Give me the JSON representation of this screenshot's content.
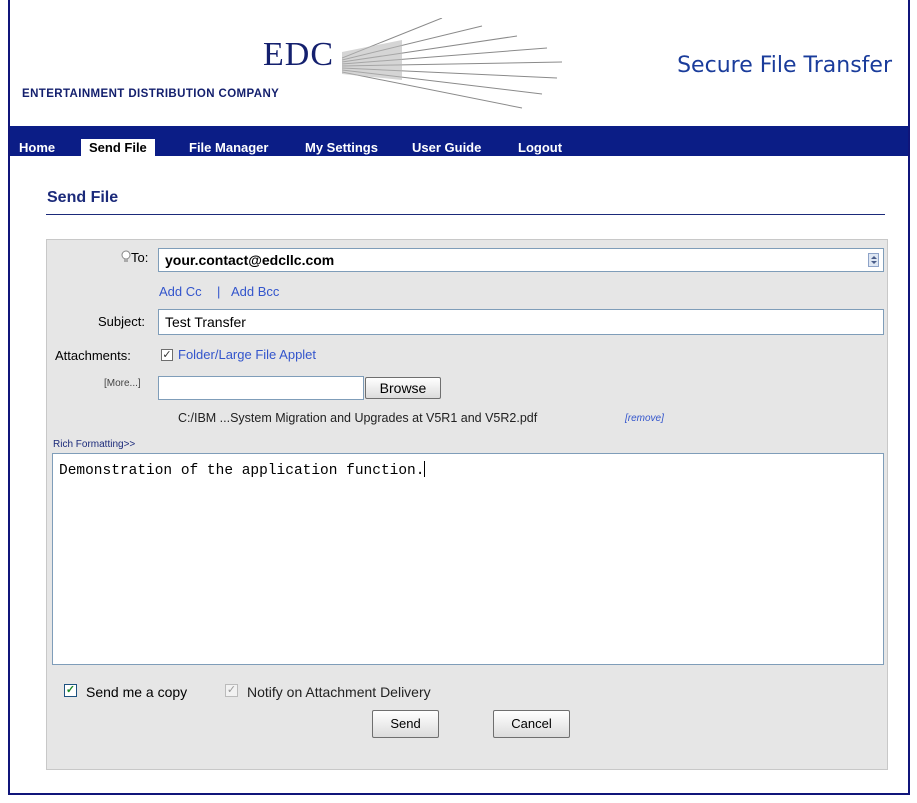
{
  "logo": {
    "name": "EDC",
    "company": "ENTERTAINMENT DISTRIBUTION COMPANY"
  },
  "app_title": "Secure File Transfer",
  "nav": [
    "Home",
    "Send File",
    "File Manager",
    "My Settings",
    "User Guide",
    "Logout"
  ],
  "nav_active": "Send File",
  "page_title": "Send File",
  "form": {
    "to_label": "To:",
    "to_value": "your.contact@edcllc.com",
    "add_cc": "Add Cc",
    "separator": "|",
    "add_bcc": "Add Bcc",
    "subject_label": "Subject:",
    "subject_value": "Test Transfer",
    "attachments_label": "Attachments:",
    "applet_label": "Folder/Large File Applet",
    "applet_checked": true,
    "more_link": "[More...]",
    "file_value": "",
    "browse_label": "Browse",
    "attached_file": "C:/IBM ...System Migration and Upgrades at V5R1 and V5R2.pdf",
    "remove_link": "[remove]",
    "rich_formatting": "Rich Formatting>>",
    "message": "Demonstration of the application function.",
    "send_copy_label": "Send me a copy",
    "send_copy_checked": true,
    "notify_label": "Notify on Attachment Delivery",
    "notify_checked": true,
    "notify_disabled": true,
    "send_label": "Send",
    "cancel_label": "Cancel"
  },
  "colors": {
    "nav_bg": "#0b1d86",
    "title": "#1b2a7a",
    "link": "#3355cc",
    "panel_bg": "#e6e6e6"
  }
}
